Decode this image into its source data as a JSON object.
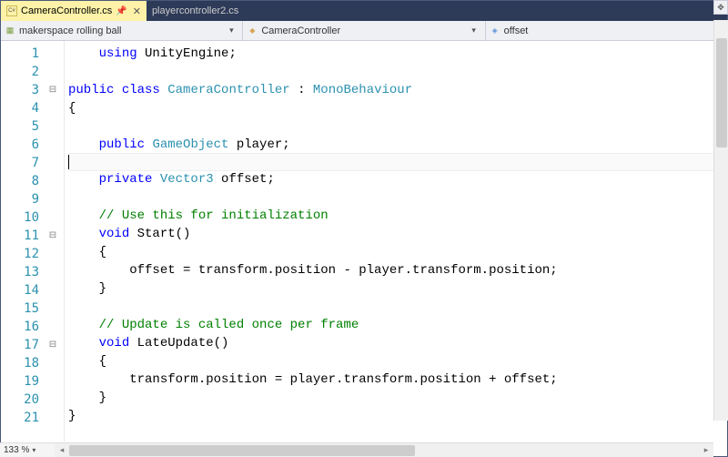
{
  "tabs": [
    {
      "label": "CameraController.cs",
      "active": true,
      "pinned": true
    },
    {
      "label": "playercontroller2.cs",
      "active": false,
      "pinned": false
    }
  ],
  "nav": {
    "project": "makerspace rolling ball",
    "class": "CameraController",
    "member": "offset"
  },
  "zoom": "133 %",
  "active_line": 7,
  "code": [
    {
      "n": 1,
      "fold": "",
      "tokens": [
        [
          "    ",
          ""
        ],
        [
          "using",
          "kw"
        ],
        [
          " ",
          ""
        ],
        [
          "UnityEngine",
          "txt"
        ],
        [
          ";",
          ""
        ]
      ]
    },
    {
      "n": 2,
      "fold": "",
      "tokens": []
    },
    {
      "n": 3,
      "fold": "⊟",
      "tokens": [
        [
          "public",
          "kw"
        ],
        [
          " ",
          ""
        ],
        [
          "class",
          "kw"
        ],
        [
          " ",
          ""
        ],
        [
          "CameraController",
          "type"
        ],
        [
          " : ",
          ""
        ],
        [
          "MonoBehaviour",
          "type"
        ]
      ]
    },
    {
      "n": 4,
      "fold": "",
      "tokens": [
        [
          "{",
          ""
        ]
      ]
    },
    {
      "n": 5,
      "fold": "",
      "tokens": []
    },
    {
      "n": 6,
      "fold": "",
      "tokens": [
        [
          "    ",
          ""
        ],
        [
          "public",
          "kw"
        ],
        [
          " ",
          ""
        ],
        [
          "GameObject",
          "type"
        ],
        [
          " player;",
          ""
        ]
      ]
    },
    {
      "n": 7,
      "fold": "",
      "tokens": [],
      "bulb": true,
      "caret": true
    },
    {
      "n": 8,
      "fold": "",
      "tokens": [
        [
          "    ",
          ""
        ],
        [
          "private",
          "kw"
        ],
        [
          " ",
          ""
        ],
        [
          "Vector3",
          "type"
        ],
        [
          " offset;",
          ""
        ]
      ]
    },
    {
      "n": 9,
      "fold": "",
      "tokens": []
    },
    {
      "n": 10,
      "fold": "",
      "tokens": [
        [
          "    ",
          ""
        ],
        [
          "// Use this for initialization",
          "com"
        ]
      ]
    },
    {
      "n": 11,
      "fold": "⊟",
      "tokens": [
        [
          "    ",
          ""
        ],
        [
          "void",
          "kw"
        ],
        [
          " ",
          ""
        ],
        [
          "Start",
          "txt"
        ],
        [
          "()",
          ""
        ]
      ]
    },
    {
      "n": 12,
      "fold": "",
      "tokens": [
        [
          "    {",
          ""
        ]
      ]
    },
    {
      "n": 13,
      "fold": "",
      "tokens": [
        [
          "        offset = transform.position - player.transform.position;",
          ""
        ]
      ]
    },
    {
      "n": 14,
      "fold": "",
      "tokens": [
        [
          "    }",
          ""
        ]
      ]
    },
    {
      "n": 15,
      "fold": "",
      "tokens": []
    },
    {
      "n": 16,
      "fold": "",
      "tokens": [
        [
          "    ",
          ""
        ],
        [
          "// Update is called once per frame",
          "com"
        ]
      ]
    },
    {
      "n": 17,
      "fold": "⊟",
      "tokens": [
        [
          "    ",
          ""
        ],
        [
          "void",
          "kw"
        ],
        [
          " ",
          ""
        ],
        [
          "LateUpdate",
          "txt"
        ],
        [
          "()",
          ""
        ]
      ]
    },
    {
      "n": 18,
      "fold": "",
      "tokens": [
        [
          "    {",
          ""
        ]
      ]
    },
    {
      "n": 19,
      "fold": "",
      "tokens": [
        [
          "        transform.position = player.transform.position + offset;",
          ""
        ]
      ]
    },
    {
      "n": 20,
      "fold": "",
      "tokens": [
        [
          "    }",
          ""
        ]
      ]
    },
    {
      "n": 21,
      "fold": "",
      "tokens": [
        [
          "}",
          ""
        ]
      ]
    }
  ]
}
